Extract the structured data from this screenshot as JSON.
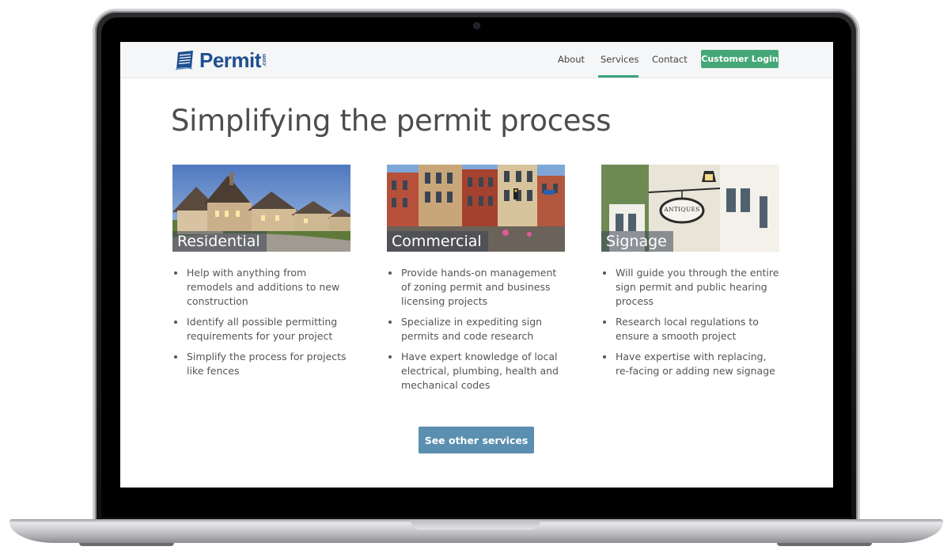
{
  "brand": {
    "name": "Permit",
    "suffix": ".com"
  },
  "nav": {
    "items": [
      {
        "label": "About"
      },
      {
        "label": "Services",
        "active": true
      },
      {
        "label": "Contact"
      }
    ],
    "login_label": "Customer Login"
  },
  "headline": "Simplifying the permit process",
  "cards": [
    {
      "title": "Residential",
      "image": "residential-houses-photo",
      "bullets": [
        "Help with anything from remodels and additions to new construction",
        "Identify all possible permitting requirements for your project",
        "Simplify the process for projects like fences"
      ]
    },
    {
      "title": "Commercial",
      "image": "commercial-street-photo",
      "bullets": [
        "Provide hands-on management of zoning permit and business licensing projects",
        "Specialize in expediting sign permits and code research",
        "Have expert knowledge of local electrical, plumbing, health and mechanical codes"
      ]
    },
    {
      "title": "Signage",
      "image": "antiques-sign-photo",
      "bullets": [
        "Will guide you through the entire sign permit and public hearing process",
        "Research local regulations to ensure a smooth project",
        "Have expertise with replacing, re-facing or adding new signage"
      ]
    }
  ],
  "signage_photo_text": "ANTIQUES",
  "cta_label": "See other services",
  "colors": {
    "brand_blue": "#1f4f8e",
    "accent_green": "#45a777",
    "cta_blue": "#5b8fb0",
    "body_text": "#555555"
  }
}
